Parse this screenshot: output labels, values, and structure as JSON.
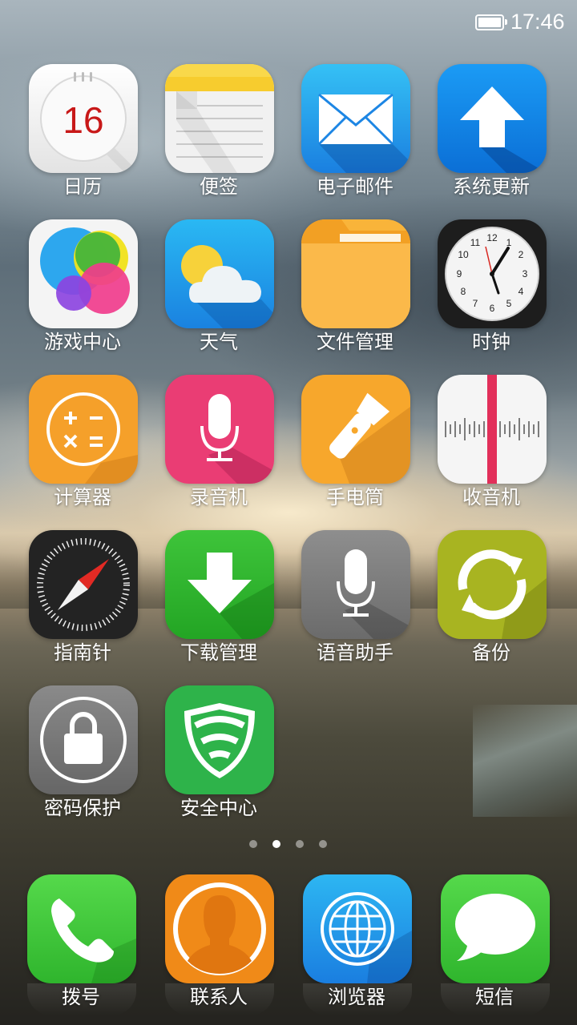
{
  "status_bar": {
    "time": "17:46",
    "battery_level": 1.0
  },
  "apps": [
    {
      "label": "日历",
      "date": "16",
      "icon": "calendar-icon"
    },
    {
      "label": "便签",
      "icon": "notes-icon"
    },
    {
      "label": "电子邮件",
      "icon": "mail-icon"
    },
    {
      "label": "系统更新",
      "icon": "update-arrow-icon"
    },
    {
      "label": "游戏中心",
      "icon": "game-center-icon"
    },
    {
      "label": "天气",
      "icon": "weather-icon"
    },
    {
      "label": "文件管理",
      "icon": "folder-icon"
    },
    {
      "label": "时钟",
      "icon": "clock-icon",
      "clock_numerals": [
        "12",
        "1",
        "2",
        "3",
        "4",
        "5",
        "6",
        "7",
        "8",
        "9",
        "10",
        "11"
      ]
    },
    {
      "label": "计算器",
      "icon": "calculator-icon"
    },
    {
      "label": "录音机",
      "icon": "recorder-icon"
    },
    {
      "label": "手电筒",
      "icon": "flashlight-icon"
    },
    {
      "label": "收音机",
      "icon": "radio-icon"
    },
    {
      "label": "指南针",
      "icon": "compass-icon"
    },
    {
      "label": "下载管理",
      "icon": "download-icon"
    },
    {
      "label": "语音助手",
      "icon": "voice-assistant-icon"
    },
    {
      "label": "备份",
      "icon": "backup-icon"
    },
    {
      "label": "密码保护",
      "icon": "lock-icon"
    },
    {
      "label": "安全中心",
      "icon": "security-shield-icon"
    }
  ],
  "page_indicator": {
    "count": 4,
    "active_index": 1
  },
  "dock": [
    {
      "label": "拨号",
      "icon": "phone-icon"
    },
    {
      "label": "联系人",
      "icon": "contacts-icon"
    },
    {
      "label": "浏览器",
      "icon": "browser-icon"
    },
    {
      "label": "短信",
      "icon": "messages-icon"
    }
  ]
}
